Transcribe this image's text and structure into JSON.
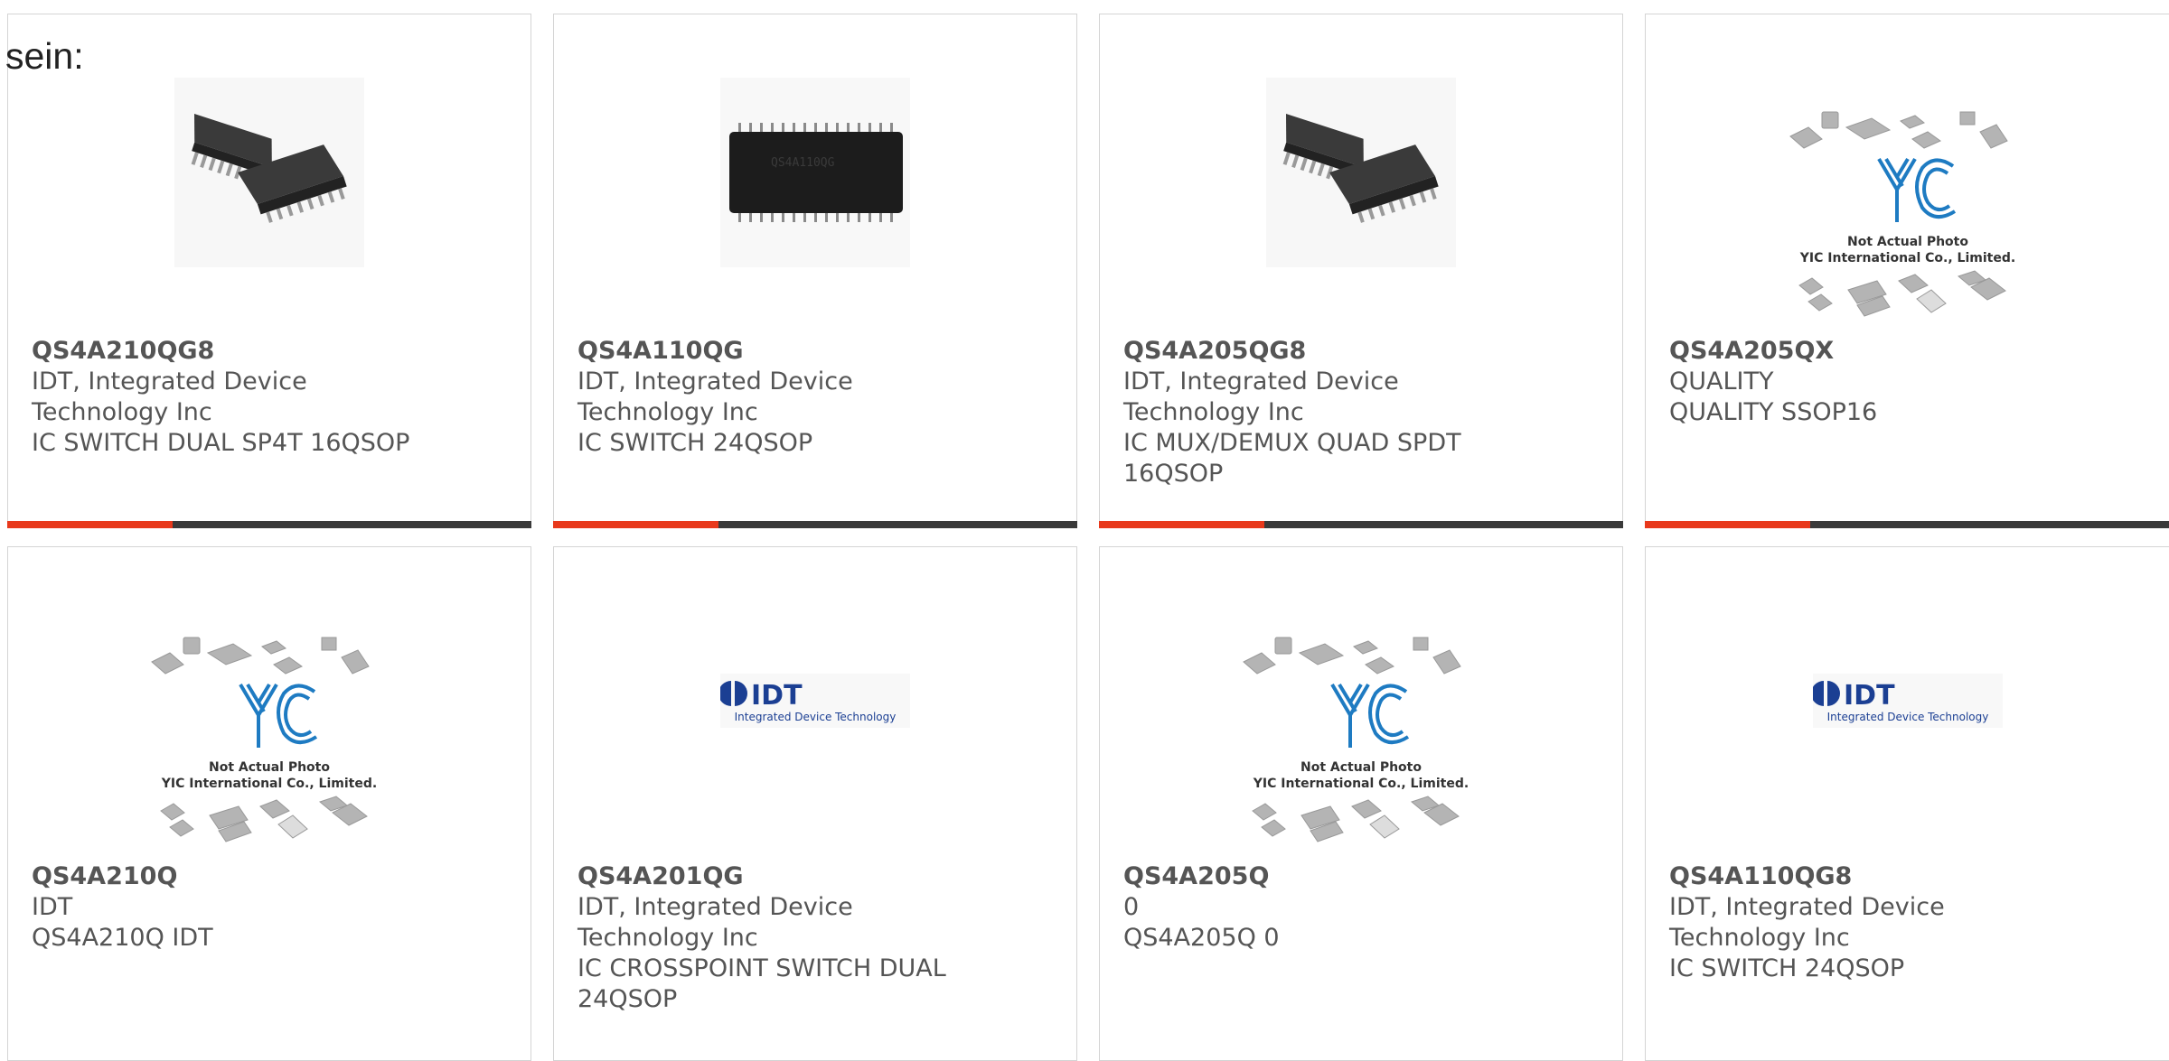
{
  "intro_text": "sein:",
  "colors": {
    "accent": "#e8391c",
    "bar_dark": "#3a3a3a",
    "border": "#d4d4d4",
    "text": "#555555"
  },
  "products": [
    {
      "part": "QS4A210QG8",
      "line1": "IDT, Integrated Device",
      "line2": "Technology Inc",
      "line3": "IC SWITCH DUAL SP4T 16QSOP",
      "line4": "",
      "image": "chip-qsop16-photo"
    },
    {
      "part": "QS4A110QG",
      "line1": "IDT, Integrated Device",
      "line2": "Technology Inc",
      "line3": "IC SWITCH 24QSOP",
      "line4": "",
      "image": "chip-qsop24-photo",
      "chip_marking": "QS4A110QG"
    },
    {
      "part": "QS4A205QG8",
      "line1": "IDT, Integrated Device",
      "line2": "Technology Inc",
      "line3": "IC MUX/DEMUX QUAD SPDT",
      "line4": "16QSOP",
      "image": "chip-qsop16-photo"
    },
    {
      "part": "QS4A205QX",
      "line1": "QUALITY",
      "line2": "QUALITY SSOP16",
      "line3": "",
      "line4": "",
      "image": "yic-placeholder",
      "placeholder": {
        "logo": "YIC",
        "caption1": "Not Actual Photo",
        "caption2": "YIC International Co., Limited."
      }
    },
    {
      "part": "QS4A210Q",
      "line1": "IDT",
      "line2": "QS4A210Q IDT",
      "line3": "",
      "line4": "",
      "image": "yic-placeholder",
      "placeholder": {
        "logo": "YIC",
        "caption1": "Not Actual Photo",
        "caption2": "YIC International Co., Limited."
      }
    },
    {
      "part": "QS4A201QG",
      "line1": "IDT, Integrated Device",
      "line2": "Technology Inc",
      "line3": "IC CROSSPOINT SWITCH DUAL",
      "line4": "24QSOP",
      "image": "idt-logo",
      "logo": {
        "mark": "IDT",
        "tagline": "Integrated Device Technology"
      }
    },
    {
      "part": "QS4A205Q",
      "line1": "0",
      "line2": "QS4A205Q 0",
      "line3": "",
      "line4": "",
      "image": "yic-placeholder",
      "placeholder": {
        "logo": "YIC",
        "caption1": "Not Actual Photo",
        "caption2": "YIC International Co., Limited."
      }
    },
    {
      "part": "QS4A110QG8",
      "line1": "IDT, Integrated Device",
      "line2": "Technology Inc",
      "line3": "IC SWITCH 24QSOP",
      "line4": "",
      "image": "idt-logo",
      "logo": {
        "mark": "IDT",
        "tagline": "Integrated Device Technology"
      }
    }
  ]
}
